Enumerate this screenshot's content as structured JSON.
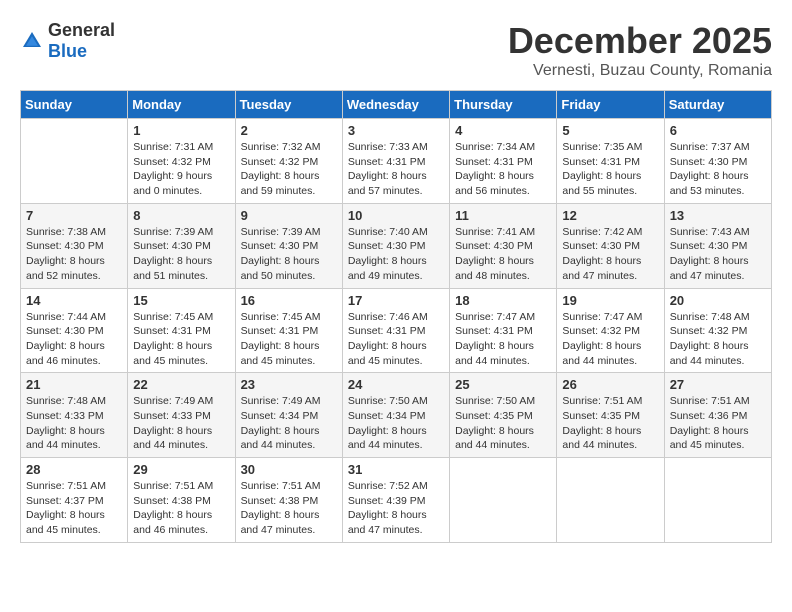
{
  "header": {
    "logo_general": "General",
    "logo_blue": "Blue",
    "month_title": "December 2025",
    "subtitle": "Vernesti, Buzau County, Romania"
  },
  "weekdays": [
    "Sunday",
    "Monday",
    "Tuesday",
    "Wednesday",
    "Thursday",
    "Friday",
    "Saturday"
  ],
  "weeks": [
    [
      {
        "day": "",
        "info": ""
      },
      {
        "day": "1",
        "info": "Sunrise: 7:31 AM\nSunset: 4:32 PM\nDaylight: 9 hours\nand 0 minutes."
      },
      {
        "day": "2",
        "info": "Sunrise: 7:32 AM\nSunset: 4:32 PM\nDaylight: 8 hours\nand 59 minutes."
      },
      {
        "day": "3",
        "info": "Sunrise: 7:33 AM\nSunset: 4:31 PM\nDaylight: 8 hours\nand 57 minutes."
      },
      {
        "day": "4",
        "info": "Sunrise: 7:34 AM\nSunset: 4:31 PM\nDaylight: 8 hours\nand 56 minutes."
      },
      {
        "day": "5",
        "info": "Sunrise: 7:35 AM\nSunset: 4:31 PM\nDaylight: 8 hours\nand 55 minutes."
      },
      {
        "day": "6",
        "info": "Sunrise: 7:37 AM\nSunset: 4:30 PM\nDaylight: 8 hours\nand 53 minutes."
      }
    ],
    [
      {
        "day": "7",
        "info": "Sunrise: 7:38 AM\nSunset: 4:30 PM\nDaylight: 8 hours\nand 52 minutes."
      },
      {
        "day": "8",
        "info": "Sunrise: 7:39 AM\nSunset: 4:30 PM\nDaylight: 8 hours\nand 51 minutes."
      },
      {
        "day": "9",
        "info": "Sunrise: 7:39 AM\nSunset: 4:30 PM\nDaylight: 8 hours\nand 50 minutes."
      },
      {
        "day": "10",
        "info": "Sunrise: 7:40 AM\nSunset: 4:30 PM\nDaylight: 8 hours\nand 49 minutes."
      },
      {
        "day": "11",
        "info": "Sunrise: 7:41 AM\nSunset: 4:30 PM\nDaylight: 8 hours\nand 48 minutes."
      },
      {
        "day": "12",
        "info": "Sunrise: 7:42 AM\nSunset: 4:30 PM\nDaylight: 8 hours\nand 47 minutes."
      },
      {
        "day": "13",
        "info": "Sunrise: 7:43 AM\nSunset: 4:30 PM\nDaylight: 8 hours\nand 47 minutes."
      }
    ],
    [
      {
        "day": "14",
        "info": "Sunrise: 7:44 AM\nSunset: 4:30 PM\nDaylight: 8 hours\nand 46 minutes."
      },
      {
        "day": "15",
        "info": "Sunrise: 7:45 AM\nSunset: 4:31 PM\nDaylight: 8 hours\nand 45 minutes."
      },
      {
        "day": "16",
        "info": "Sunrise: 7:45 AM\nSunset: 4:31 PM\nDaylight: 8 hours\nand 45 minutes."
      },
      {
        "day": "17",
        "info": "Sunrise: 7:46 AM\nSunset: 4:31 PM\nDaylight: 8 hours\nand 45 minutes."
      },
      {
        "day": "18",
        "info": "Sunrise: 7:47 AM\nSunset: 4:31 PM\nDaylight: 8 hours\nand 44 minutes."
      },
      {
        "day": "19",
        "info": "Sunrise: 7:47 AM\nSunset: 4:32 PM\nDaylight: 8 hours\nand 44 minutes."
      },
      {
        "day": "20",
        "info": "Sunrise: 7:48 AM\nSunset: 4:32 PM\nDaylight: 8 hours\nand 44 minutes."
      }
    ],
    [
      {
        "day": "21",
        "info": "Sunrise: 7:48 AM\nSunset: 4:33 PM\nDaylight: 8 hours\nand 44 minutes."
      },
      {
        "day": "22",
        "info": "Sunrise: 7:49 AM\nSunset: 4:33 PM\nDaylight: 8 hours\nand 44 minutes."
      },
      {
        "day": "23",
        "info": "Sunrise: 7:49 AM\nSunset: 4:34 PM\nDaylight: 8 hours\nand 44 minutes."
      },
      {
        "day": "24",
        "info": "Sunrise: 7:50 AM\nSunset: 4:34 PM\nDaylight: 8 hours\nand 44 minutes."
      },
      {
        "day": "25",
        "info": "Sunrise: 7:50 AM\nSunset: 4:35 PM\nDaylight: 8 hours\nand 44 minutes."
      },
      {
        "day": "26",
        "info": "Sunrise: 7:51 AM\nSunset: 4:35 PM\nDaylight: 8 hours\nand 44 minutes."
      },
      {
        "day": "27",
        "info": "Sunrise: 7:51 AM\nSunset: 4:36 PM\nDaylight: 8 hours\nand 45 minutes."
      }
    ],
    [
      {
        "day": "28",
        "info": "Sunrise: 7:51 AM\nSunset: 4:37 PM\nDaylight: 8 hours\nand 45 minutes."
      },
      {
        "day": "29",
        "info": "Sunrise: 7:51 AM\nSunset: 4:38 PM\nDaylight: 8 hours\nand 46 minutes."
      },
      {
        "day": "30",
        "info": "Sunrise: 7:51 AM\nSunset: 4:38 PM\nDaylight: 8 hours\nand 47 minutes."
      },
      {
        "day": "31",
        "info": "Sunrise: 7:52 AM\nSunset: 4:39 PM\nDaylight: 8 hours\nand 47 minutes."
      },
      {
        "day": "",
        "info": ""
      },
      {
        "day": "",
        "info": ""
      },
      {
        "day": "",
        "info": ""
      }
    ]
  ]
}
